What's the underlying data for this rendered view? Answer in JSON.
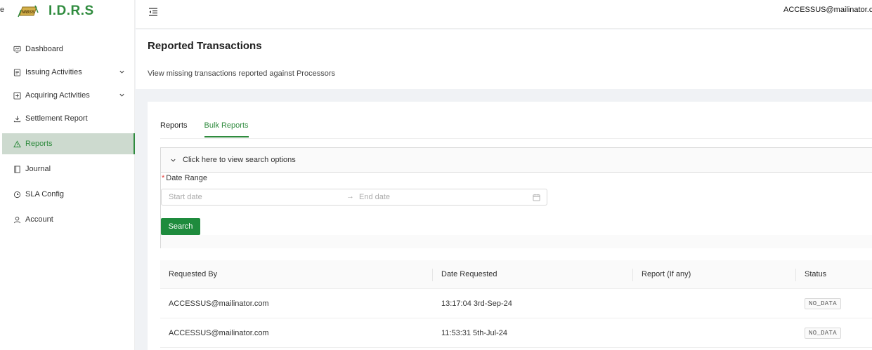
{
  "app": {
    "name": "I.D.R.S",
    "edge_char": "e",
    "logo_text": "NIBSS"
  },
  "header": {
    "user_email": "ACCESSUS@mailinator.com"
  },
  "sidebar": {
    "items": [
      {
        "label": "Dashboard",
        "icon": "dashboard-icon",
        "expandable": false
      },
      {
        "label": "Issuing Activities",
        "icon": "issuing-icon",
        "expandable": true
      },
      {
        "label": "Acquiring Activities",
        "icon": "acquiring-icon",
        "expandable": true
      },
      {
        "label": "Settlement Report",
        "icon": "download-icon",
        "expandable": false
      },
      {
        "label": "Reports",
        "icon": "warning-icon",
        "expandable": false,
        "active": true
      },
      {
        "label": "Journal",
        "icon": "journal-icon",
        "expandable": false
      },
      {
        "label": "SLA Config",
        "icon": "sla-icon",
        "expandable": false
      },
      {
        "label": "Account",
        "icon": "user-icon",
        "expandable": false
      }
    ]
  },
  "page": {
    "title": "Reported Transactions",
    "subtitle": "View missing transactions reported against Processors"
  },
  "tabs": [
    {
      "label": "Reports",
      "active": false
    },
    {
      "label": "Bulk Reports",
      "active": true
    }
  ],
  "search": {
    "toggle_label": "Click here to view search options",
    "date_range_label": "Date Range",
    "required_mark": "*",
    "start_placeholder": "Start date",
    "end_placeholder": "End date",
    "button_label": "Search"
  },
  "table": {
    "columns": [
      "Requested By",
      "Date Requested",
      "Report (If any)",
      "Status"
    ],
    "rows": [
      {
        "requested_by": "ACCESSUS@mailinator.com",
        "date_requested": "13:17:04 3rd-Sep-24",
        "report": "",
        "status": "NO_DATA"
      },
      {
        "requested_by": "ACCESSUS@mailinator.com",
        "date_requested": "11:53:31 5th-Jul-24",
        "report": "",
        "status": "NO_DATA"
      }
    ]
  },
  "colors": {
    "brand": "#2f8b3e",
    "primary_button": "#1e8b3d",
    "active_bg": "#cddacf"
  }
}
